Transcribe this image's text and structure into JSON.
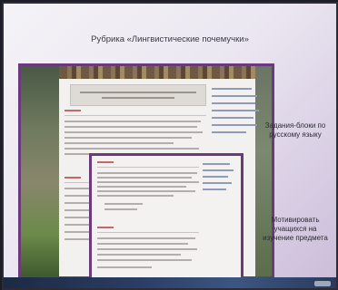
{
  "slide": {
    "title": "Рубрика «Лингвистические почемучки»",
    "annotations": [
      "Задания-блоки по русскому языку",
      "Мотивировать учащихся на изучение предмета"
    ]
  },
  "colors": {
    "frame": "#6b3a7d",
    "background": "#ebe7f1"
  }
}
